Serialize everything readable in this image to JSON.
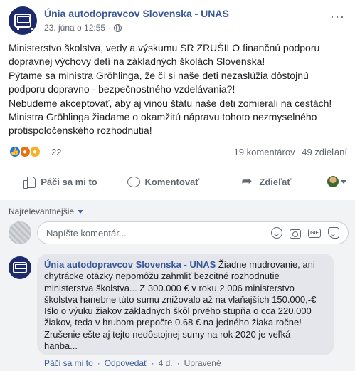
{
  "post": {
    "page_name": "Únia autodopravcov Slovenska - UNAS",
    "timestamp": "23. júna o 12:55",
    "dot": "·",
    "more": "···",
    "lines": [
      "Ministerstvo školstva, vedy a výskumu SR ZRUŠILO finančnú podporu",
      "dopravnej výchovy detí na základných školách Slovenska!",
      "Pýtame sa ministra Gröhlinga, že či si naše deti nezaslúžia dôstojnú",
      "podporu dopravno - bezpečnostného vzdelávania?!",
      "Nebudeme akceptovať, aby aj vinou štátu naše deti zomierali na cestách!",
      "Ministra Gröhlinga žiadame o okamžitú nápravu tohoto nezmyselného",
      "protispoločenského rozhodnutia!"
    ]
  },
  "reactions": {
    "count": "22",
    "comments": "19 komentárov",
    "shares": "49 zdieľaní"
  },
  "actions": {
    "like": "Páči sa mi to",
    "comment": "Komentovať",
    "share": "Zdieľať"
  },
  "comments_section": {
    "sort_label": "Najrelevantnejšie",
    "input_placeholder": "Napíšte komentár...",
    "input_icons": [
      "smiley-icon",
      "camera-icon",
      "gif-icon",
      "sticker-icon"
    ],
    "gif_text": "GIF"
  },
  "comment": {
    "author": "Únia autodopravcov Slovenska - UNAS",
    "first_line_rest": " Žiadne mudrovanie, ani",
    "lines": [
      "chytrácke otázky nepomôžu zahmliť bezcitné rozhodnutie",
      "ministerstva školstva... Z 300.000 € v roku 2.006 ministerstvo",
      "školstva hanebne túto sumu znižovalo až na vlaňajších 150.000,-€",
      "Išlo o výuku žiakov základných škôl prvého stupňa o cca 220.000",
      "žiakov, teda v hrubom prepočte 0.68 € na jedného žiaka ročne!",
      "Zrušenie ešte aj tejto nedôstojnej sumy na rok 2020 je veľká",
      "hanba..."
    ],
    "like": "Páči sa mi to",
    "reply": "Odpovedať",
    "age": "4 d.",
    "edited": "Upravené",
    "sep": "·"
  },
  "colors": {
    "link": "#385898",
    "like_blue": "#1877f2",
    "angry": "#e9710f",
    "haha": "#f7b125"
  }
}
